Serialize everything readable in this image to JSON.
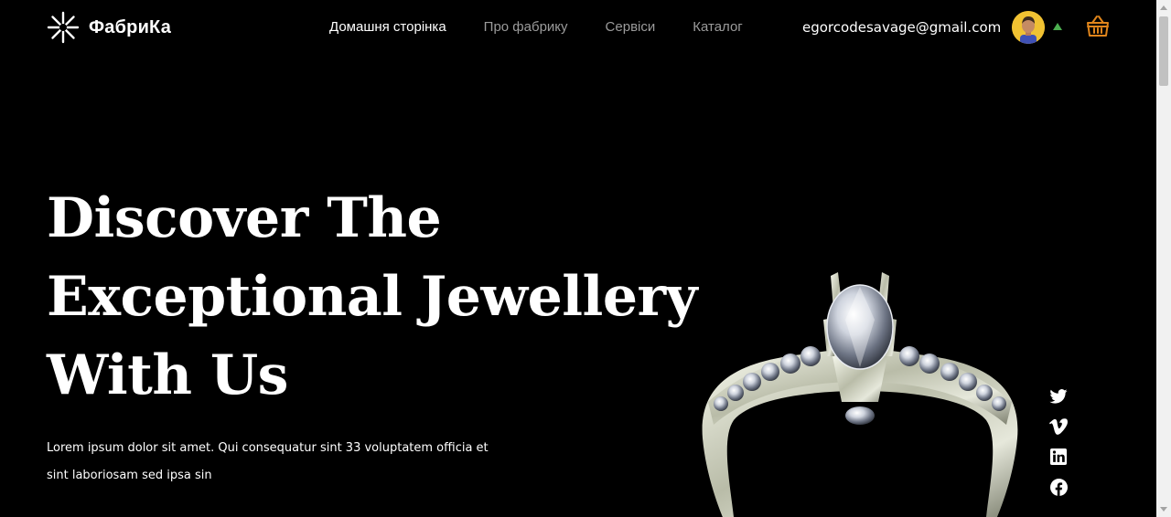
{
  "brand": {
    "name": "ФабриКа",
    "logo_icon": "asterisk-star-icon"
  },
  "nav": {
    "items": [
      {
        "label": "Домашня сторінка",
        "active": true
      },
      {
        "label": "Про фабрику",
        "active": false
      },
      {
        "label": "Сервіси",
        "active": false
      },
      {
        "label": "Каталог",
        "active": false
      }
    ]
  },
  "user": {
    "email": "egorcodesavage@gmail.com",
    "avatar_icon": "user-avatar",
    "menu_caret_color": "#4caf50"
  },
  "cart": {
    "icon": "basket-icon",
    "color": "#e0851b"
  },
  "hero": {
    "title_lines": [
      "Discover The",
      "Exceptional Jewellery",
      "With Us"
    ],
    "subtitle": "Lorem ipsum dolor sit amet. Qui consequatur sint 33 voluptatem officia et sint laboriosam sed ipsa sin",
    "image": "diamond-engagement-ring"
  },
  "social": [
    "twitter-icon",
    "vimeo-icon",
    "linkedin-icon",
    "facebook-icon"
  ],
  "colors": {
    "background": "#000000",
    "text": "#ffffff",
    "nav_inactive": "#9b9b9b"
  }
}
